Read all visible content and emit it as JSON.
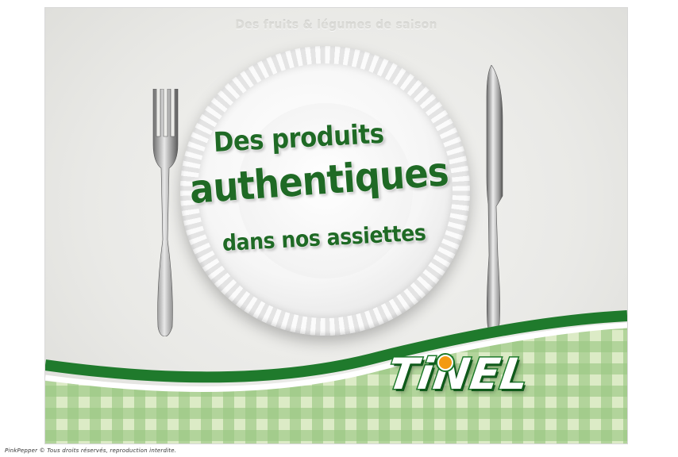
{
  "poster": {
    "tagline": "Des fruits & légumes de saison",
    "headline_line1": "Des produits",
    "headline_line2": "authentiques",
    "headline_line3": "dans nos assiettes",
    "logo_text": "TiNEL",
    "colors": {
      "brand_green": "#1f6a25",
      "logo_green": "#1c7a2a",
      "logo_dot": "#f39a12",
      "gingham_light": "#cfe3b4",
      "gingham_dark": "#7fb563"
    }
  },
  "footer": {
    "copyright": "PinkPepper © Tous droits réservés, reproduction interdite."
  }
}
